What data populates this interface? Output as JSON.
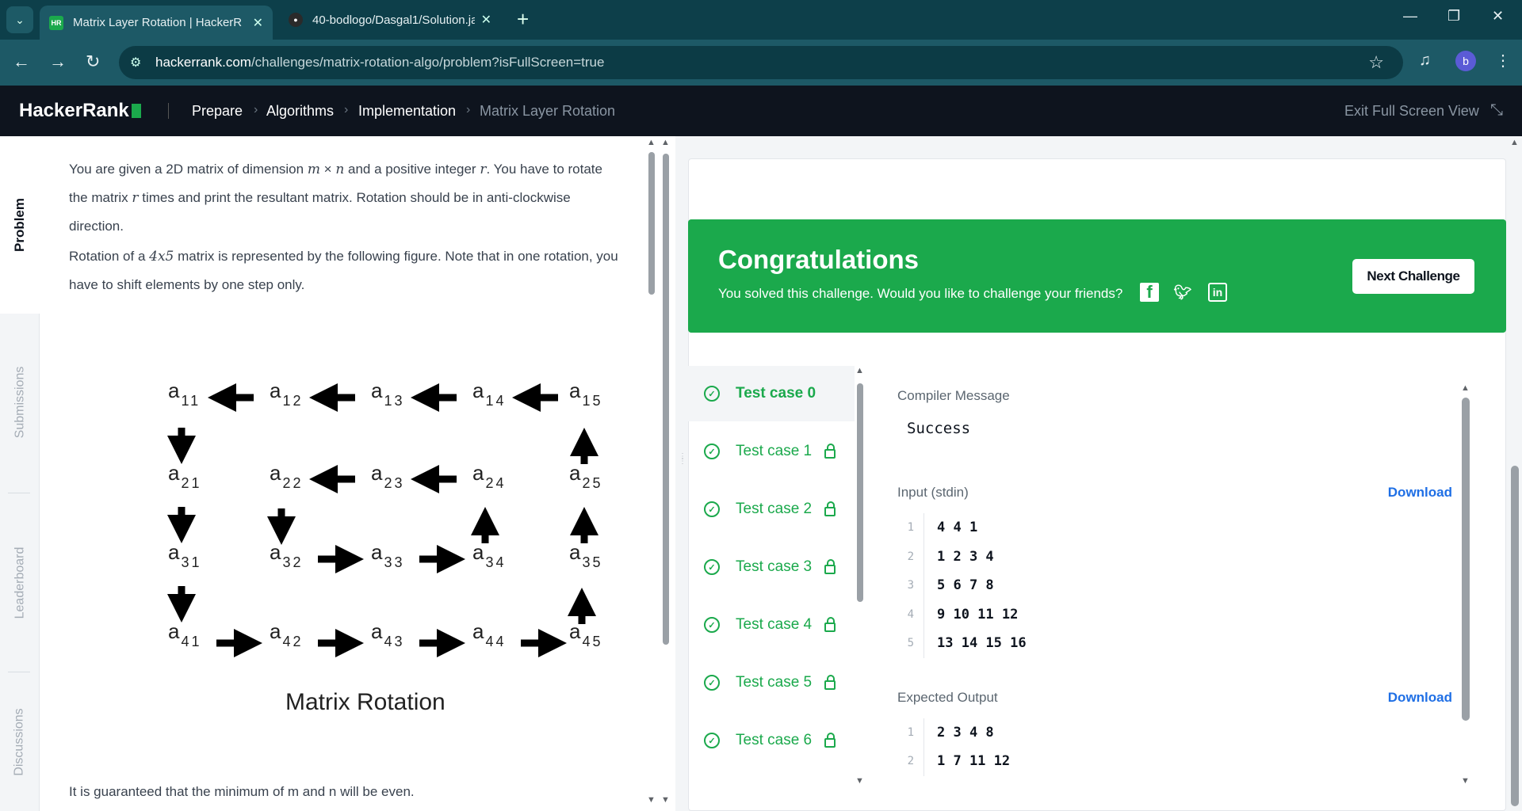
{
  "browser": {
    "tabs": [
      {
        "title": "Matrix Layer Rotation | HackerR",
        "favicon": "HR",
        "active": true
      },
      {
        "title": "40-bodlogo/Dasgal1/Solution.ja",
        "favicon": "github-icon",
        "active": false
      }
    ],
    "url_host": "hackerrank.com",
    "url_path": "/challenges/matrix-rotation-algo/problem?isFullScreen=true",
    "profile_initial": "b"
  },
  "header": {
    "logo": "HackerRank",
    "breadcrumbs": [
      "Prepare",
      "Algorithms",
      "Implementation",
      "Matrix Layer Rotation"
    ],
    "exit_fullscreen": "Exit Full Screen View"
  },
  "sidetabs": [
    "Problem",
    "Submissions",
    "Leaderboard",
    "Discussions"
  ],
  "problem": {
    "p1_a": "You are given a 2D matrix of dimension ",
    "p1_m": "m",
    "p1_x": " × ",
    "p1_n": "n",
    "p1_b": " and a positive integer ",
    "p1_r": "r",
    "p1_c": ". You have to rotate the matrix ",
    "p1_r2": "r",
    "p1_d": " times and print the resultant matrix. Rotation should be in anti-clockwise direction.",
    "p2_a": "Rotation of a ",
    "p2_dim": "4x5",
    "p2_b": " matrix is represented by the following figure. Note that in one rotation, you have to shift elements by one step only.",
    "figure_title": "Matrix Rotation",
    "footer": "It is guaranteed that the minimum of m and n will be even."
  },
  "figure_cells": [
    {
      "s": "11"
    },
    {
      "s": "12"
    },
    {
      "s": "13"
    },
    {
      "s": "14"
    },
    {
      "s": "15"
    },
    {
      "s": "21"
    },
    {
      "s": "22"
    },
    {
      "s": "23"
    },
    {
      "s": "24"
    },
    {
      "s": "25"
    },
    {
      "s": "31"
    },
    {
      "s": "32"
    },
    {
      "s": "33"
    },
    {
      "s": "34"
    },
    {
      "s": "35"
    },
    {
      "s": "41"
    },
    {
      "s": "42"
    },
    {
      "s": "43"
    },
    {
      "s": "44"
    },
    {
      "s": "45"
    }
  ],
  "banner": {
    "title": "Congratulations",
    "subtitle": "You solved this challenge. Would you like to challenge your friends?",
    "next": "Next Challenge"
  },
  "tests": [
    "Test case 0",
    "Test case 1",
    "Test case 2",
    "Test case 3",
    "Test case 4",
    "Test case 5",
    "Test case 6"
  ],
  "output": {
    "compiler_label": "Compiler Message",
    "compiler_msg": "Success",
    "input_label": "Input (stdin)",
    "download": "Download",
    "input_lines": [
      "4 4 1",
      "1 2 3 4",
      "5 6 7 8",
      "9 10 11 12",
      "13 14 15 16"
    ],
    "expected_label": "Expected Output",
    "expected_lines": [
      "2 3 4 8",
      "1 7 11 12"
    ]
  },
  "colors": {
    "accent": "#1ba94c",
    "link": "#1f6fe5",
    "header_bg": "#0e141e"
  }
}
